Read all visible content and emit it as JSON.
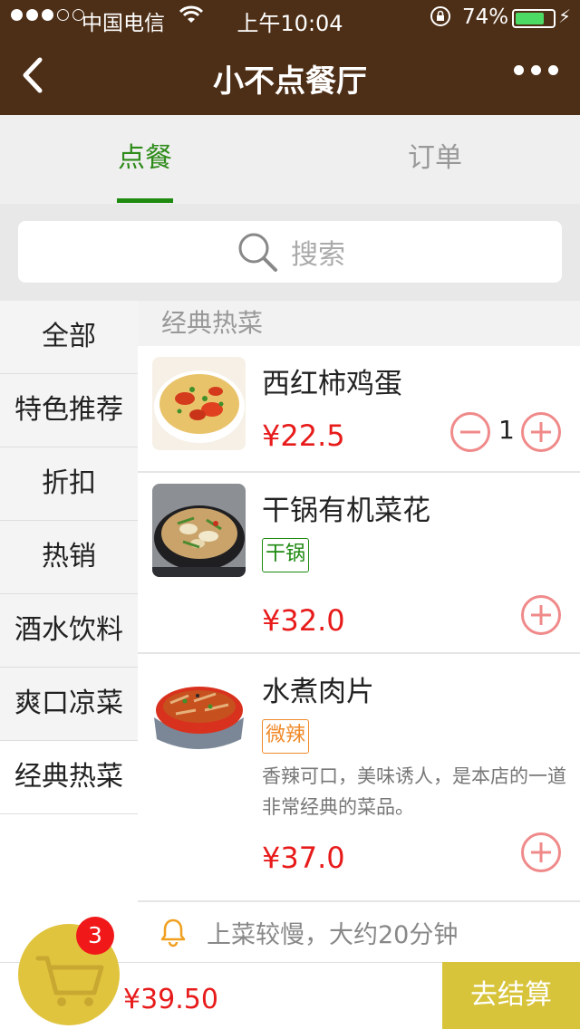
{
  "status_bar": {
    "carrier": "中国电信",
    "time": "上午10:04",
    "battery": "74%"
  },
  "nav": {
    "title": "小不点餐厅"
  },
  "tabs": [
    {
      "label": "点餐"
    },
    {
      "label": "订单"
    }
  ],
  "search": {
    "placeholder": "搜索"
  },
  "sidebar": {
    "items": [
      {
        "label": "全部"
      },
      {
        "label": "特色推荐"
      },
      {
        "label": "折扣"
      },
      {
        "label": "热销"
      },
      {
        "label": "酒水饮料"
      },
      {
        "label": "爽口凉菜"
      },
      {
        "label": "经典热菜"
      }
    ]
  },
  "section": {
    "title": "经典热菜"
  },
  "dishes": [
    {
      "name": "西红柿鸡蛋",
      "price": "¥22.5",
      "quantity": "1"
    },
    {
      "name": "干锅有机菜花",
      "tag": "干锅",
      "price": "¥32.0"
    },
    {
      "name": "水煮肉片",
      "tag": "微辣",
      "description": "香辣可口，美味诱人，是本店的一道非常经典的菜品。",
      "price": "¥37.0"
    }
  ],
  "notice": {
    "text": "上菜较慢，大约20分钟"
  },
  "cart": {
    "count": "3",
    "total": "¥39.50",
    "checkout_label": "去结算"
  },
  "colors": {
    "nav_bg": "#4d2e16",
    "accent_green": "#1e8a10",
    "price_red": "#e81b1b",
    "cart_yellow": "#e0c43e"
  }
}
